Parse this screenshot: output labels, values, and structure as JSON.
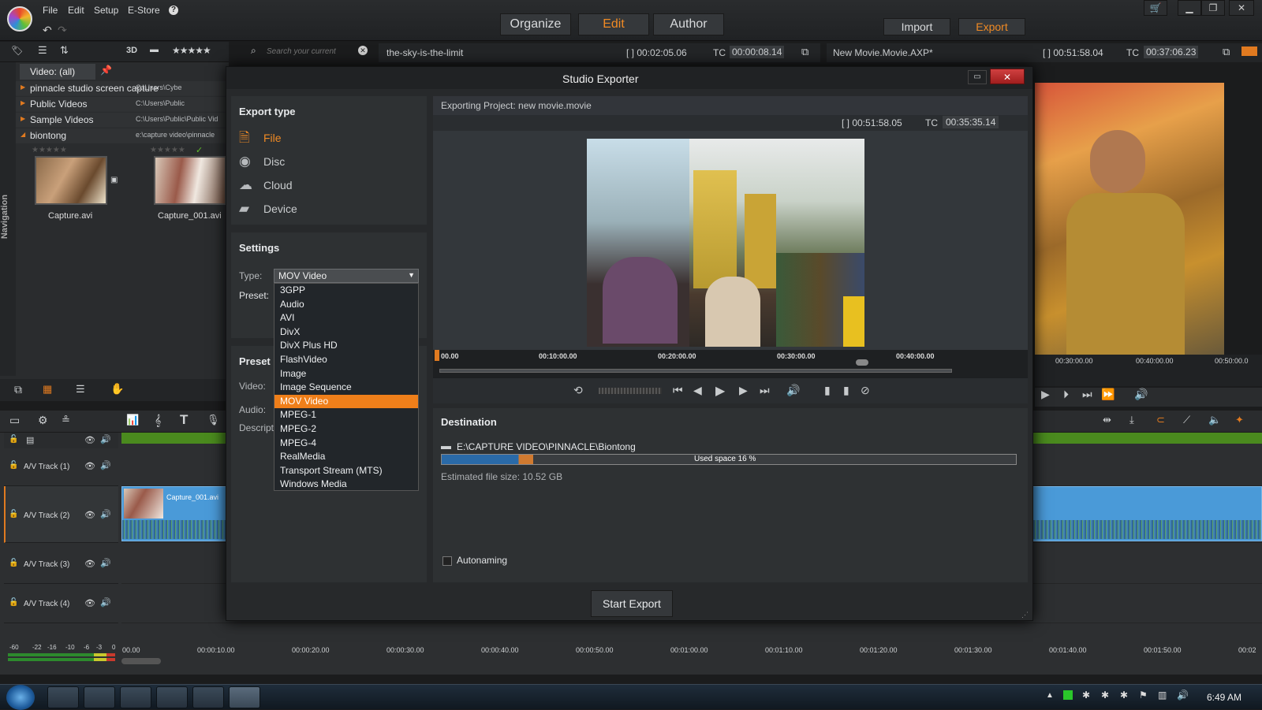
{
  "topbar": {
    "menu": [
      "File",
      "Edit",
      "Setup",
      "E-Store"
    ],
    "modes": [
      "Organize",
      "Edit",
      "Author"
    ],
    "active_mode": "Edit",
    "import_label": "Import",
    "export_label": "Export"
  },
  "library": {
    "view_3d": "3D",
    "stars": "★★★★★",
    "search_placeholder": "Search your current",
    "category": "Video: (all)",
    "tree": [
      {
        "name": "pinnacle studio screen capture",
        "path": "C:\\Users\\Cybe"
      },
      {
        "name": "Public Videos",
        "path": "C:\\Users\\Public"
      },
      {
        "name": "Sample Videos",
        "path": "C:\\Users\\Public\\Public Vid"
      },
      {
        "name": "biontong",
        "path": "e:\\capture video\\pinnacle"
      }
    ],
    "clips": [
      {
        "label": "Capture.avi"
      },
      {
        "label": "Capture_001.avi"
      }
    ],
    "navigation_label": "Navigation"
  },
  "source_preview": {
    "title": "the-sky-is-the-limit",
    "duration": "[ ] 00:02:05.06",
    "tc_label": "TC",
    "tc_value": "00:00:08.14"
  },
  "movie_preview": {
    "title": "New Movie.Movie.AXP*",
    "duration": "[ ] 00:51:58.04",
    "tc_label": "TC",
    "tc_value": "00:37:06.23",
    "ruler": [
      "00:30:00.00",
      "00:40:00.00",
      "00:50:00.0"
    ]
  },
  "dialog": {
    "title": "Studio Exporter",
    "export_type_heading": "Export type",
    "export_types": [
      {
        "label": "File",
        "icon": "file-export-icon"
      },
      {
        "label": "Disc",
        "icon": "disc-icon"
      },
      {
        "label": "Cloud",
        "icon": "cloud-icon"
      },
      {
        "label": "Device",
        "icon": "device-icon"
      }
    ],
    "active_export_type": "File",
    "settings_heading": "Settings",
    "type_label": "Type:",
    "type_value": "MOV Video",
    "preset_label": "Preset:",
    "type_options": [
      "3GPP",
      "Audio",
      "AVI",
      "DivX",
      "DivX Plus HD",
      "FlashVideo",
      "Image",
      "Image Sequence",
      "MOV Video",
      "MPEG-1",
      "MPEG-2",
      "MPEG-4",
      "RealMedia",
      "Transport Stream (MTS)",
      "Windows Media"
    ],
    "preset_section_heading": "Preset",
    "preset_video_label": "Video:",
    "preset_audio_label": "Audio:",
    "preset_desc_label": "Descript",
    "exporting_project": "Exporting Project: new movie.movie",
    "preview_duration": "[ ] 00:51:58.05",
    "preview_tc_label": "TC",
    "preview_tc_value": "00:35:35.14",
    "ruler": [
      "00.00",
      "00:10:00.00",
      "00:20:00.00",
      "00:30:00.00",
      "00:40:00.00"
    ],
    "destination_heading": "Destination",
    "destination_path": "E:\\CAPTURE VIDEO\\PINNACLE\\Biontong",
    "used_space_label": "Used space 16 %",
    "used_space_fraction": 0.16,
    "estimated_size": "Estimated file size: 10.52 GB",
    "autonaming_label": "Autonaming",
    "start_export_label": "Start Export"
  },
  "timeline": {
    "tracks": [
      {
        "label": "A/V Track (1)"
      },
      {
        "label": "A/V Track (2)"
      },
      {
        "label": "A/V Track (3)"
      },
      {
        "label": "A/V Track (4)"
      }
    ],
    "clip_label": "Capture_001.avi",
    "meter_labels": [
      "-60",
      "-22",
      "-16",
      "-10",
      "-6",
      "-3",
      "0"
    ],
    "timecodes": [
      "00.00",
      "00:00:10.00",
      "00:00:20.00",
      "00:00:30.00",
      "00:00:40.00",
      "00:00:50.00",
      "00:01:00.00",
      "00:01:10.00",
      "00:01:20.00",
      "00:01:30.00",
      "00:01:40.00",
      "00:01:50.00",
      "00:02"
    ]
  },
  "taskbar": {
    "clock": "6:49 AM"
  },
  "colors": {
    "accent": "#f08a24",
    "selection": "#ef7f1a",
    "track_green": "#4a8a1e",
    "clip_blue": "#4a9ad8"
  }
}
